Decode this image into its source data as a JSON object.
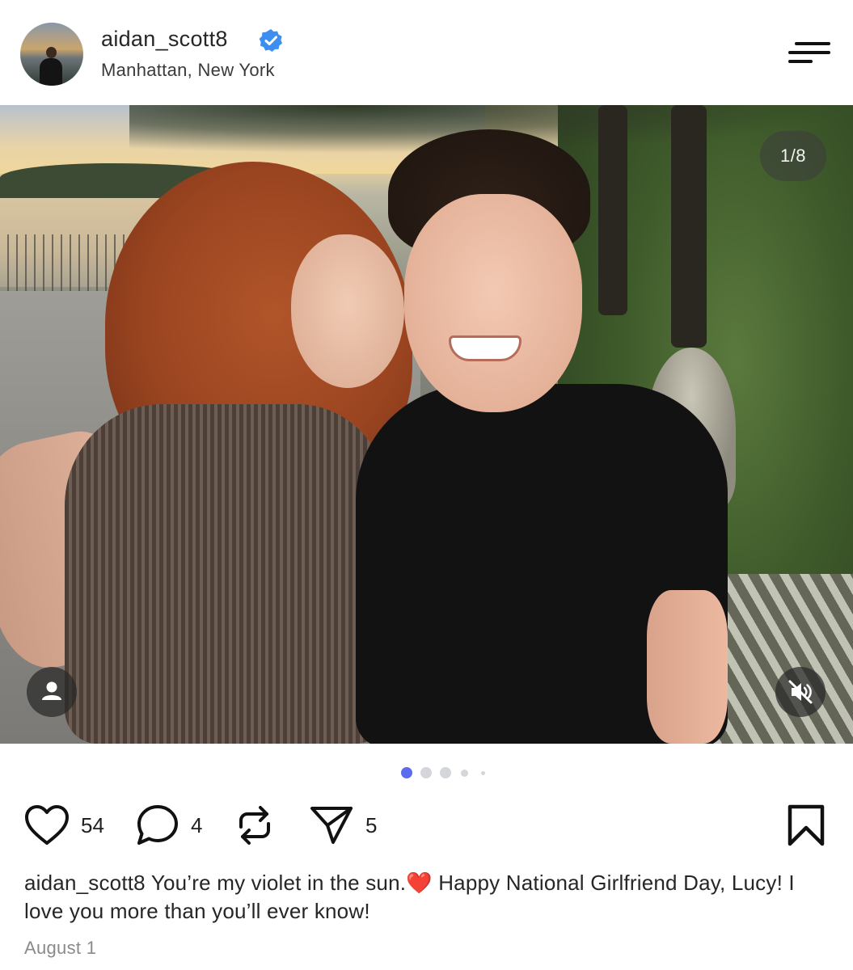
{
  "header": {
    "username": "aidan_scott8",
    "verified": true,
    "location": "Manhattan, New York",
    "menu_icon": "hamburger-menu-icon"
  },
  "photo": {
    "counter": "1/8",
    "tag_icon": "person-icon",
    "mute_icon": "speaker-muted-icon"
  },
  "carousel": {
    "total_dots_visible": 5,
    "active_index": 0,
    "active_color": "#5b6cf0",
    "inactive_color": "#d4d6dc"
  },
  "actions": {
    "likes": "54",
    "comments": "4",
    "shares": "5",
    "icons": [
      "heart-icon",
      "comment-bubble-icon",
      "repost-icon",
      "send-icon",
      "bookmark-icon"
    ]
  },
  "caption": {
    "username": "aidan_scott8",
    "text_before_emoji": "You’re my violet in the sun.",
    "emoji": "❤️",
    "text_after_emoji": "Happy National Girlfriend Day, Lucy! I love you more than you’ll ever know!"
  },
  "date": "August 1",
  "colors": {
    "verified_badge": "#3d8ef0",
    "heart_emoji": "#e0263a"
  }
}
